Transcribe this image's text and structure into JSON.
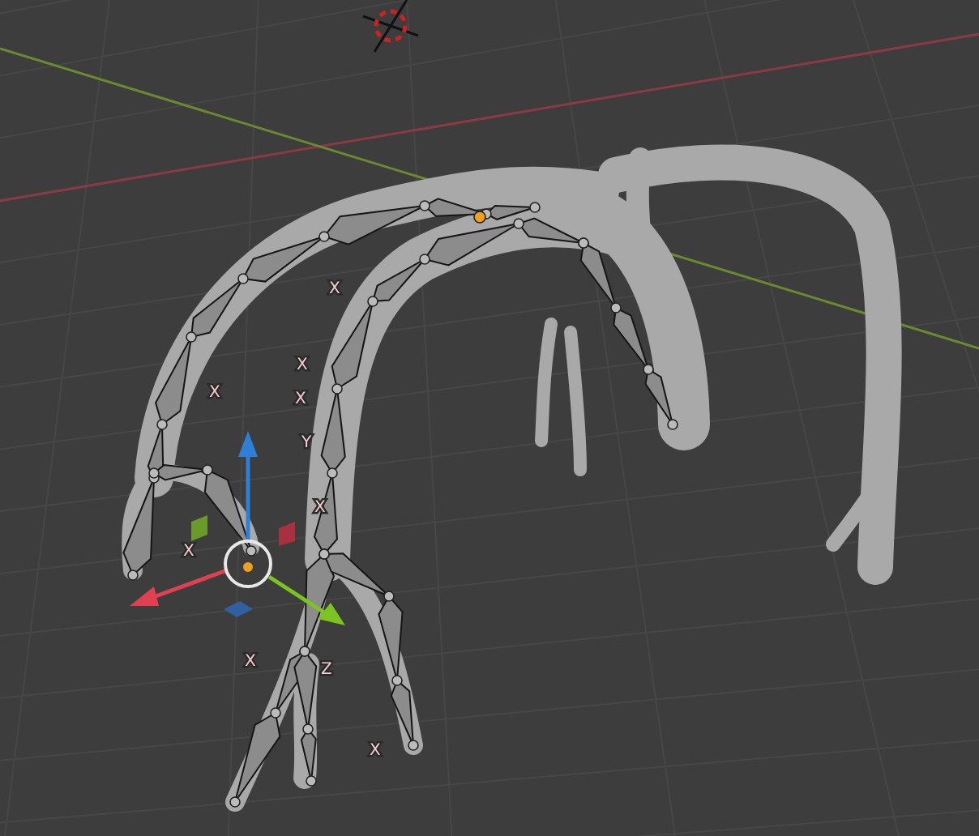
{
  "viewport": {
    "bone_axis_labels": [
      "X",
      "X",
      "X",
      "X",
      "Y",
      "X",
      "X",
      "X",
      "Z",
      "X"
    ]
  }
}
